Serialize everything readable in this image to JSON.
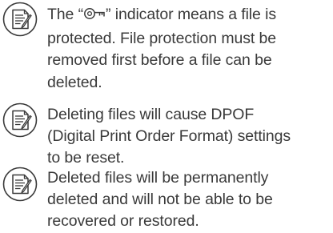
{
  "notes": [
    {
      "icon": "note-memo-icon",
      "lines": [
        {
          "before": "The “",
          "glyph": "protect-key-icon",
          "after": "” indicator means a file is"
        },
        {
          "text": "protected. File protection must be"
        },
        {
          "text": "removed first before a file can be"
        },
        {
          "text": "deleted."
        }
      ]
    },
    {
      "icon": "note-memo-icon",
      "lines": [
        {
          "text": "Deleting files will cause DPOF"
        },
        {
          "text": "(Digital Print Order Format) settings"
        },
        {
          "text": "to be reset."
        }
      ]
    },
    {
      "icon": "note-memo-icon",
      "lines": [
        {
          "text": "Deleted files will be permanently"
        },
        {
          "text": "deleted and will not be able to be"
        },
        {
          "text": "recovered or restored."
        }
      ]
    }
  ],
  "colors": {
    "text": "#3a3a3a",
    "icon": "#3a3a3a"
  }
}
